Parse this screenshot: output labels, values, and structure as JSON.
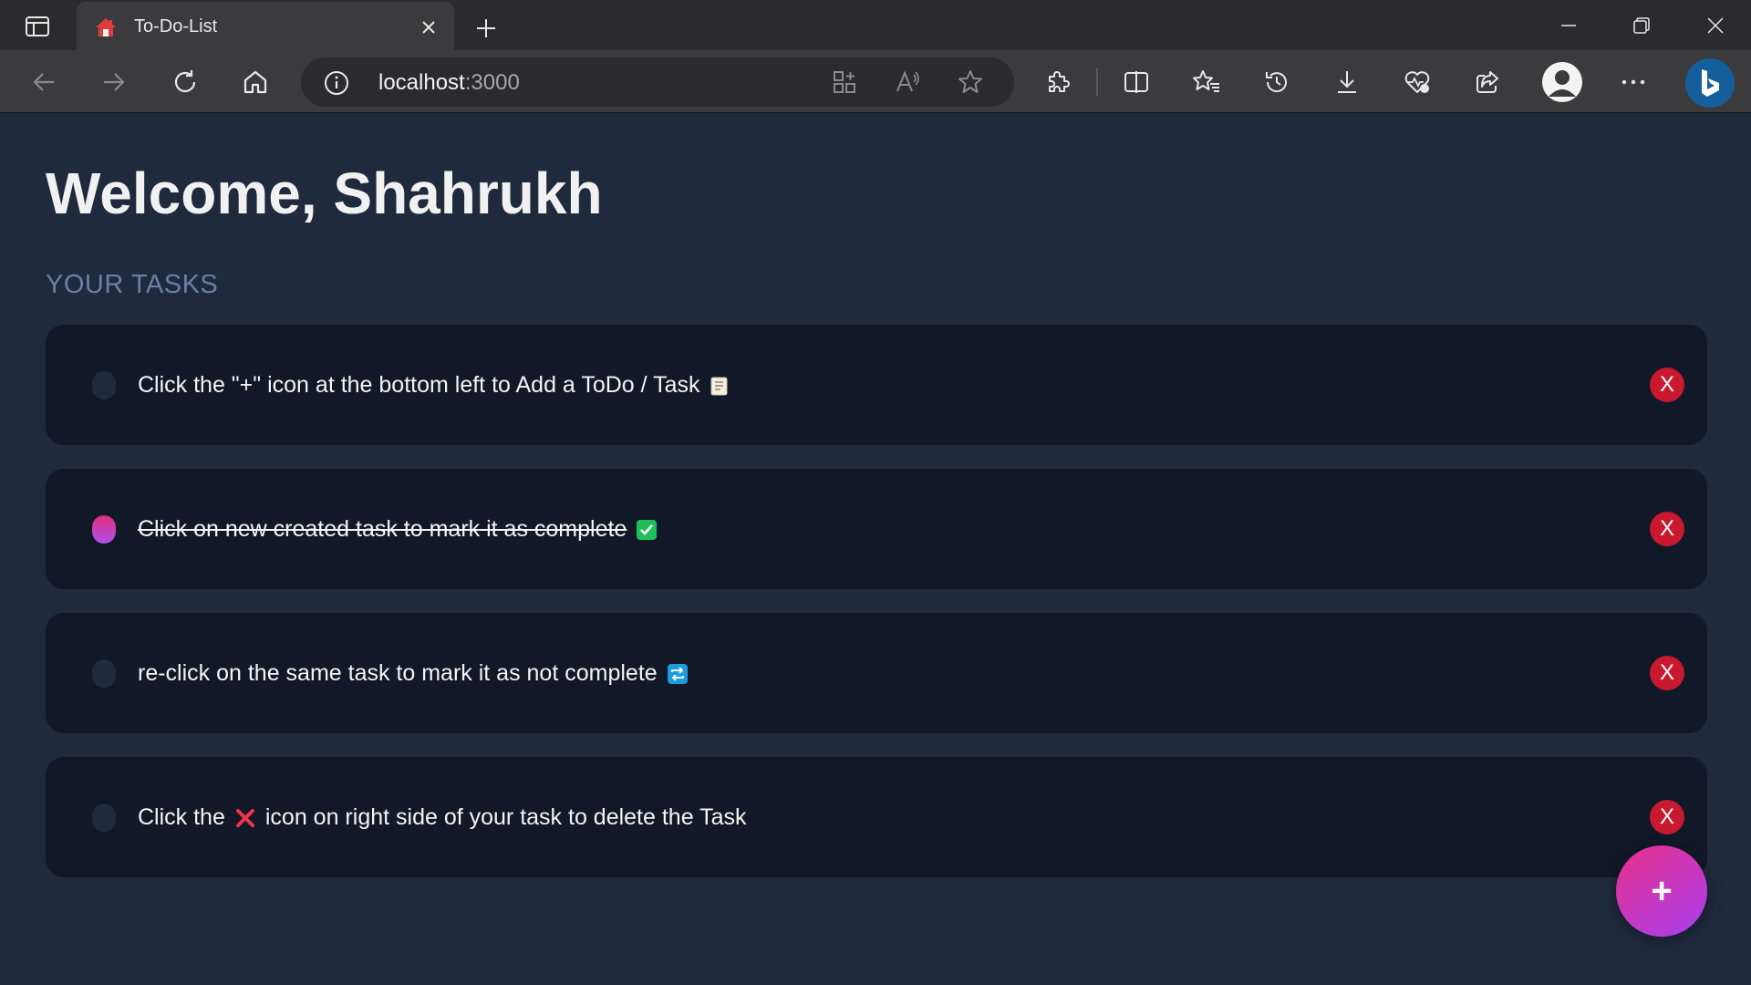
{
  "browser": {
    "tab_title": "To-Do-List",
    "url_host": "localhost",
    "url_port": ":3000"
  },
  "page": {
    "welcome": "Welcome, Shahrukh",
    "section_title": "YOUR TASKS",
    "tasks": [
      {
        "text_before": "Click the \"+\" icon at the bottom left to Add a ToDo / Task",
        "emoji": "scroll-icon",
        "text_after": "",
        "completed": false,
        "delete_label": "X"
      },
      {
        "text_before": "Click on new created task to mark it as complete",
        "emoji": "check-mark-button-icon",
        "text_after": "",
        "completed": true,
        "delete_label": "X"
      },
      {
        "text_before": "re-click on the same task to mark it as not complete",
        "emoji": "repeat-icon",
        "text_after": "",
        "completed": false,
        "delete_label": "X"
      },
      {
        "text_before": "Click the",
        "emoji": "cross-mark-icon",
        "text_after": "icon on right side of your task to delete the Task",
        "completed": false,
        "delete_label": "X"
      }
    ],
    "fab_label": "+"
  },
  "colors": {
    "page_bg": "#1f2a3d",
    "card_bg": "#111827",
    "delete_red": "#c8192f",
    "accent_pink": "#e8308a",
    "accent_purple": "#a83ff0"
  }
}
